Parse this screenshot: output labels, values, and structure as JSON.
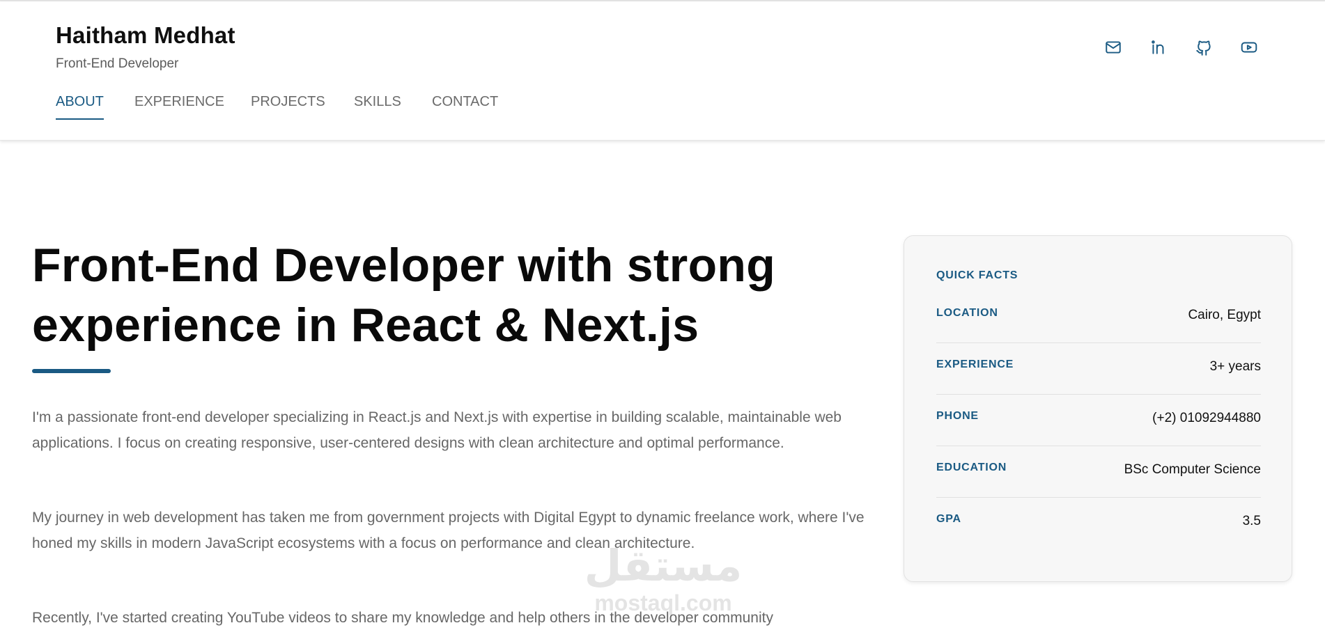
{
  "header": {
    "name": "Haitham Medhat",
    "role": "Front-End Developer"
  },
  "nav": {
    "items": [
      {
        "label": "ABOUT",
        "active": true
      },
      {
        "label": "EXPERIENCE",
        "active": false
      },
      {
        "label": "PROJECTS",
        "active": false
      },
      {
        "label": "SKILLS",
        "active": false
      },
      {
        "label": "CONTACT",
        "active": false
      }
    ]
  },
  "socials": [
    {
      "icon": "mail-icon"
    },
    {
      "icon": "linkedin-icon"
    },
    {
      "icon": "github-icon"
    },
    {
      "icon": "youtube-icon"
    }
  ],
  "hero": {
    "title": "Front-End Developer with strong experience in React & Next.js",
    "paragraphs": [
      "I'm a passionate front-end developer specializing in React.js and Next.js with expertise in building scalable, maintainable web applications. I focus on creating responsive, user-centered designs with clean architecture and optimal performance.",
      "My journey in web development has taken me from government projects with Digital Egypt to dynamic freelance work, where I've honed my skills in modern JavaScript ecosystems with a focus on performance and clean architecture.",
      "Recently, I've started creating YouTube videos to share my knowledge and help others in the developer community"
    ]
  },
  "facts": {
    "title": "QUICK FACTS",
    "rows": [
      {
        "label": "LOCATION",
        "value": "Cairo, Egypt"
      },
      {
        "label": "EXPERIENCE",
        "value": "3+ years"
      },
      {
        "label": "PHONE",
        "value": "(+2) 01092944880"
      },
      {
        "label": "EDUCATION",
        "value": "BSc Computer Science"
      },
      {
        "label": "GPA",
        "value": "3.5"
      }
    ]
  },
  "watermark": {
    "arabic": "مستقل",
    "latin": "mostaql.com"
  },
  "colors": {
    "accent": "#1a5a83",
    "text": "#111111",
    "muted": "#676767",
    "card_bg": "#f7f7f7"
  }
}
